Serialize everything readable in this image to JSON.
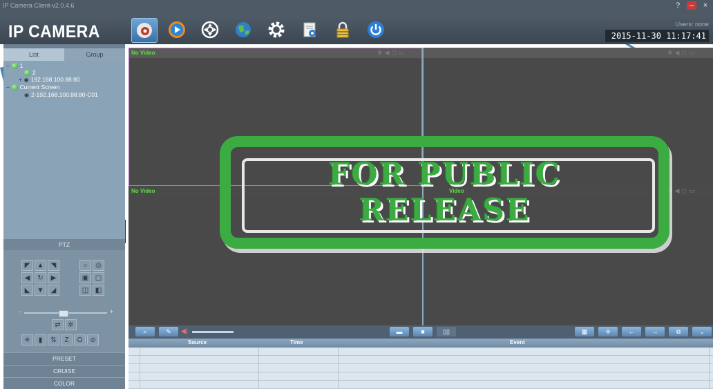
{
  "window": {
    "title": "IP Camera Client-v2.0.4.6",
    "controls": [
      "?",
      "–",
      "×"
    ]
  },
  "header": {
    "logo": "IP CAMERA",
    "toolbar": [
      {
        "icon": "camera-icon",
        "active": true
      },
      {
        "icon": "playback-icon",
        "active": false
      },
      {
        "icon": "ptz-wheel-icon",
        "active": false
      },
      {
        "icon": "globe-icon",
        "active": false
      },
      {
        "icon": "gear-icon",
        "active": false
      },
      {
        "icon": "log-icon",
        "active": false
      },
      {
        "icon": "lock-icon",
        "active": false
      },
      {
        "icon": "power-icon",
        "active": false
      }
    ],
    "users": "Users: none",
    "datetime": "2015-11-30 11:17:41"
  },
  "sidebar": {
    "tabs": [
      "List",
      "Group"
    ],
    "tree": {
      "root": "1",
      "child": "2",
      "device": "192.168.100.88:80",
      "current_screen": "Current Screen",
      "channel": "2-192.168.100.88:80-C01"
    },
    "ptz_label": "PTZ",
    "slider_minus": "-",
    "slider_plus": "+",
    "sections": [
      "PRESET",
      "CRUISE",
      "COLOR"
    ]
  },
  "video": {
    "panes": [
      "No Video",
      "",
      "No Video",
      "Video"
    ]
  },
  "stamp": {
    "line1": "FOR PUBLIC",
    "line2": "RELEASE"
  },
  "event_table": {
    "columns": [
      "Source",
      "Time",
      "Event"
    ]
  },
  "colors": {
    "stamp_green": "#3bab42",
    "video_label_green": "#5fe040",
    "selection_border": "#b070c0"
  }
}
